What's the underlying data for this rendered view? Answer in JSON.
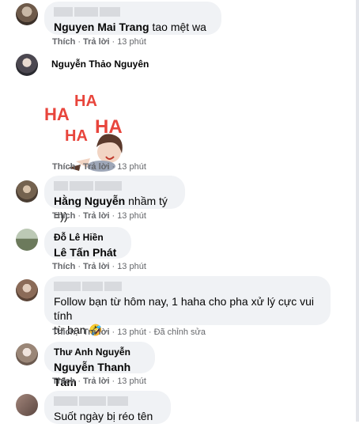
{
  "comments": [
    {
      "author": "",
      "tag": "Nguyen Mai Trang",
      "text": "tao mệt wa",
      "actions": {
        "like": "Thích",
        "reply": "Trả lời",
        "time": "13 phút"
      }
    },
    {
      "author": "Nguyễn Thảo Nguyên",
      "sticker_text": [
        "HA",
        "HA",
        "HA",
        "HA"
      ],
      "actions": {
        "like": "Thích",
        "reply": "Trả lời",
        "time": "13 phút"
      }
    },
    {
      "author": "",
      "tag": "Hằng Nguyễn",
      "text": "nhầm tý =))",
      "actions": {
        "like": "Thích",
        "reply": "Trả lời",
        "time": "13 phút"
      }
    },
    {
      "author": "Đỗ Lê Hiền",
      "tag": "Lê Tấn Phát",
      "text": "",
      "actions": {
        "like": "Thích",
        "reply": "Trả lời",
        "time": "13 phút"
      }
    },
    {
      "author": "",
      "text_line1": "Follow bạn từ hôm nay, 1 haha cho pha xử lý cực vui tính",
      "text_line2": "từ bạn 🤣",
      "actions": {
        "like": "Thích",
        "reply": "Trả lời",
        "time": "13 phút",
        "edited": "Đã chỉnh sửa"
      }
    },
    {
      "author": "Thư Anh Nguyễn",
      "tag": "Nguyễn Thanh Tâm",
      "text": "",
      "actions": {
        "like": "Thích",
        "reply": "Trả lời",
        "time": "13 phút"
      }
    },
    {
      "author": "",
      "text": "Suốt ngày bị réo tên"
    }
  ],
  "colors": {
    "bubble": "#f0f2f5",
    "meta": "#65676b",
    "text": "#050505",
    "sticker": "#e8453c"
  }
}
